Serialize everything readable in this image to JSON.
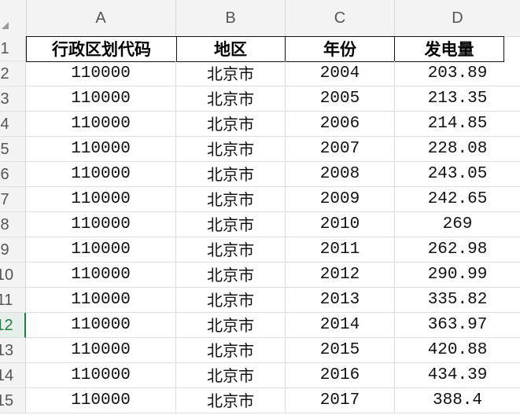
{
  "columns": [
    "A",
    "B",
    "C",
    "D"
  ],
  "row_numbers": [
    "1",
    "2",
    "3",
    "4",
    "5",
    "6",
    "7",
    "8",
    "9",
    "10",
    "11",
    "12",
    "13",
    "14",
    "15"
  ],
  "active_row": "12",
  "headers": [
    "行政区划代码",
    "地区",
    "年份",
    "发电量"
  ],
  "rows": [
    [
      "110000",
      "北京市",
      "2004",
      "203.89"
    ],
    [
      "110000",
      "北京市",
      "2005",
      "213.35"
    ],
    [
      "110000",
      "北京市",
      "2006",
      "214.85"
    ],
    [
      "110000",
      "北京市",
      "2007",
      "228.08"
    ],
    [
      "110000",
      "北京市",
      "2008",
      "243.05"
    ],
    [
      "110000",
      "北京市",
      "2009",
      "242.65"
    ],
    [
      "110000",
      "北京市",
      "2010",
      "269"
    ],
    [
      "110000",
      "北京市",
      "2011",
      "262.98"
    ],
    [
      "110000",
      "北京市",
      "2012",
      "290.99"
    ],
    [
      "110000",
      "北京市",
      "2013",
      "335.82"
    ],
    [
      "110000",
      "北京市",
      "2014",
      "363.97"
    ],
    [
      "110000",
      "北京市",
      "2015",
      "420.88"
    ],
    [
      "110000",
      "北京市",
      "2016",
      "434.39"
    ],
    [
      "110000",
      "北京市",
      "2017",
      "388.4"
    ]
  ]
}
